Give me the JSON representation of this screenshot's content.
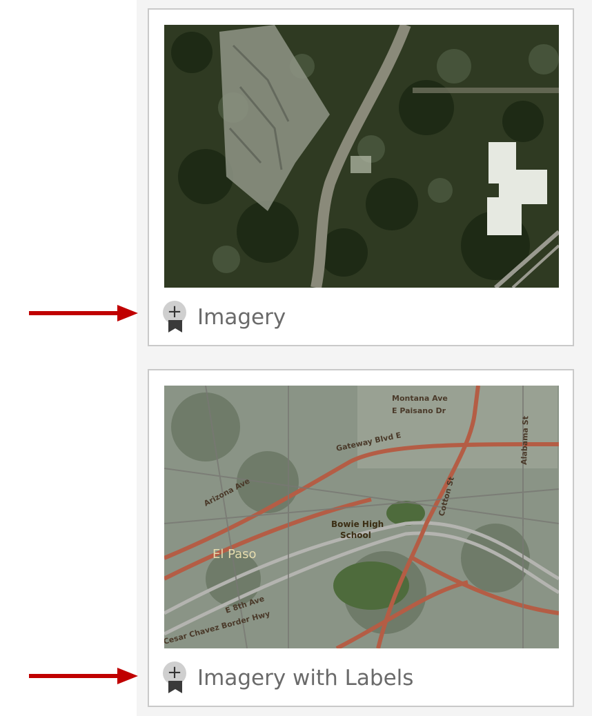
{
  "gallery": {
    "items": [
      {
        "title": "Imagery",
        "add_icon": "plus-badge-icon",
        "thumbnail": "satellite-imagery-thumbnail"
      },
      {
        "title": "Imagery with Labels",
        "add_icon": "plus-badge-icon",
        "thumbnail": "satellite-imagery-labels-thumbnail",
        "map_labels": {
          "street1": "Montana Ave",
          "street2": "E Paisano Dr",
          "street3": "Gateway Blvd E",
          "street4": "Cotton St",
          "street5": "Alabama St",
          "street6": "Arizona Ave",
          "place": "El Paso",
          "school1": "Bowie High",
          "school2": "School",
          "street7": "E 8th Ave",
          "street8": "Cesar Chavez Border Hwy"
        }
      }
    ]
  },
  "annotations": {
    "arrow_color": "#c00000"
  }
}
